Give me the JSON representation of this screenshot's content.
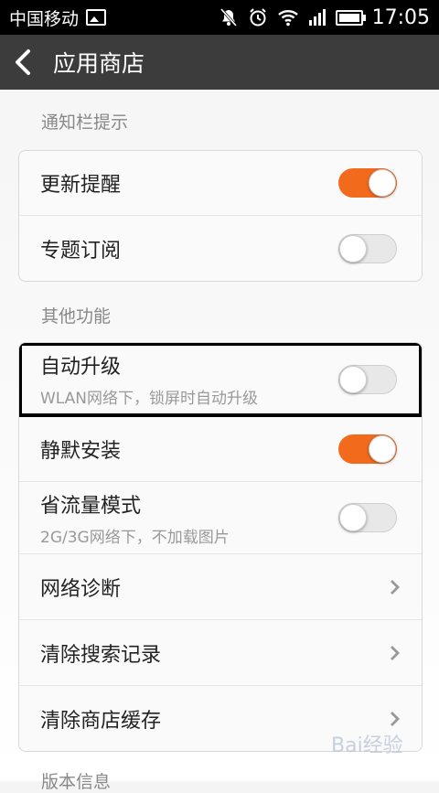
{
  "status_bar": {
    "carrier": "中国移动",
    "time": "17:05"
  },
  "header": {
    "title": "应用商店"
  },
  "sections": [
    {
      "label": "通知栏提示",
      "items": [
        {
          "title": "更新提醒",
          "control": "toggle",
          "on": true
        },
        {
          "title": "专题订阅",
          "control": "toggle",
          "on": false
        }
      ]
    },
    {
      "label": "其他功能",
      "items": [
        {
          "title": "自动升级",
          "subtitle": "WLAN网络下，锁屏时自动升级",
          "control": "toggle",
          "on": false
        },
        {
          "title": "静默安装",
          "control": "toggle",
          "on": true
        },
        {
          "title": "省流量模式",
          "subtitle": "2G/3G网络下，不加载图片",
          "control": "toggle",
          "on": false
        },
        {
          "title": "网络诊断",
          "control": "chevron"
        },
        {
          "title": "清除搜索记录",
          "control": "chevron"
        },
        {
          "title": "清除商店缓存",
          "control": "chevron"
        }
      ]
    },
    {
      "label": "版本信息"
    }
  ],
  "watermark": "Bai经验",
  "colors": {
    "accent": "#f26b1d",
    "header_bg": "#3c3c3c",
    "status_bg": "#000000"
  },
  "icons": [
    "image-icon",
    "mute-icon",
    "alarm-icon",
    "wifi-icon",
    "signal-icon",
    "battery-icon",
    "back-arrow-icon",
    "chevron-right-icon"
  ]
}
